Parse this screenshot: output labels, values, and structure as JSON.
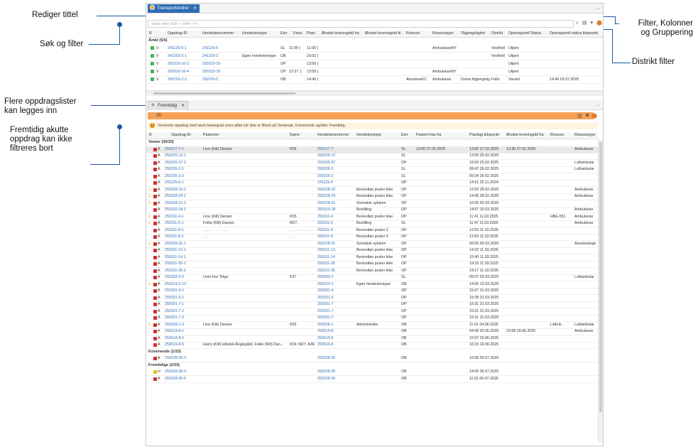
{
  "callouts": {
    "rediger": "Rediger tittel",
    "sok": "Søk og filter",
    "flere_1": "Flere oppdragslister",
    "flere_2": "kan legges inn",
    "fremtidig_1": "Fremtidig akutte",
    "fremtidig_2": "oppdrag kan ikke",
    "fremtidig_3": "filtreres bort",
    "filter_1": "Filter, Kolonner",
    "filter_2": "og Gruppering",
    "distrikt": "Distrikt filter"
  },
  "panel1": {
    "tab_label": "Transportordrer",
    "search_placeholder": "Søke etter (Ctrl + Shift + F)",
    "columns": [
      "R",
      "Oppdrag-ID",
      "Hendelsesnummer",
      "Hendelsestype",
      "Eier",
      "Fasis",
      "Planl",
      "Ønsket leveringstid fra",
      "Ønsket leveringstid til",
      "Ressurs",
      "Ressurstype",
      "Tilgjengelighet",
      "Distrikt",
      "Operasjonell Status",
      "Operasjonell status tidspunkt"
    ],
    "group": "Åmkt (5/5)",
    "rows": [
      {
        "p": "V",
        "id": "241129-6-1",
        "hn": "241129-6",
        "ht": "",
        "eier": "SL",
        "fasis": "11:00 (",
        "planl": "11:00 (",
        "res": "",
        "rtype": "AmbulanseNY",
        "tilg": "",
        "dist": "Vestfold",
        "ops": "Ulijent",
        "opt": ""
      },
      {
        "p": "V",
        "id": "241203-2-1",
        "hn": "241203-2",
        "ht": "Egen hendelsestype",
        "eier": "UB",
        "fasis": "",
        "planl": "10:52 (",
        "res": "",
        "rtype": "",
        "tilg": "",
        "dist": "Vestfold",
        "ops": "Ulijent",
        "opt": ""
      },
      {
        "p": "V",
        "id": "250310-10-2",
        "hn": "250310-10",
        "ht": "",
        "eier": "OP",
        "fasis": "",
        "planl": "13:59 (",
        "res": "",
        "rtype": "",
        "tilg": "",
        "dist": "",
        "ops": "Ulijent",
        "opt": ""
      },
      {
        "p": "V",
        "id": "250310-10-4",
        "hn": "250310-10",
        "ht": "",
        "eier": "OP",
        "fasis": "12:37 1",
        "planl": "13:59 (",
        "res": "",
        "rtype": "AmbulanseNY",
        "tilg": "",
        "dist": "",
        "ops": "Ulijent",
        "opt": ""
      },
      {
        "p": "V",
        "id": "250703-2-2",
        "hn": "250703-2",
        "ht": "",
        "eier": "OB",
        "fasis": "",
        "planl": "14:40 (",
        "res": "AbulanseFC",
        "rtype": "Ambulanse",
        "tilg": "Delvis tilgjengelig",
        "dist": "Follo",
        "ops": "Varslet",
        "opt": "14:49 03.07.2025"
      }
    ]
  },
  "panel2": {
    "tab_label": "Fremtidig",
    "filter_text": "25",
    "info_text": "Ventende oppdrag med akutt hastegrad vises alltid når liste er filtrert på Ventende, Kommende og/eller Fremtidig.",
    "columns": [
      "R",
      "Oppdrag-ID",
      "Pasienter",
      "Kjønn",
      "Hendelsesnummer",
      "Hendelsestype",
      "Eier",
      "Pasient klar fra",
      "Planlagt tidspunkt",
      "Ønsket leveringstid fra",
      "Ressurs",
      "Ressurstype"
    ],
    "groups": [
      {
        "label": "Venter (30/33)",
        "rows": [
          {
            "w": "",
            "c": "red",
            "p": "A",
            "id": "250227-7-1",
            "pas": "Line (Kilt) Danser",
            "k": "K55",
            "hn": "250227-7",
            "ht": "",
            "e": "SL",
            "kf": "13:00 27.02.2025",
            "pt": "13:00 27.02.2025",
            "ol": "13:30 27.02.2025",
            "r": "",
            "rt": "Ambulanse",
            "sel": true
          },
          {
            "w": "",
            "c": "red",
            "p": "A",
            "id": "250225-12-1",
            "pas": "",
            "k": "",
            "hn": "250225-12",
            "ht": "",
            "e": "SL",
            "kf": "",
            "pt": "13:55 25.02.2025",
            "ol": "",
            "r": "",
            "rt": ""
          },
          {
            "w": "",
            "c": "red",
            "p": "A",
            "id": "250225-37-2",
            "pas": "",
            "k": "",
            "hn": "250225-37",
            "ht": "",
            "e": "OP",
            "kf": "",
            "pt": "16:02 25.02.2025",
            "ol": "",
            "r": "",
            "rt": "Luftambular"
          },
          {
            "w": "",
            "c": "red",
            "p": "A",
            "id": "250226-2-1",
            "pas": "",
            "k": "",
            "hn": "250226-2",
            "ht": "",
            "e": "SL",
            "kf": "",
            "pt": "09:47 26.02.2025",
            "ol": "",
            "r": "",
            "rt": "Luftambular"
          },
          {
            "w": "",
            "c": "red",
            "p": "A",
            "id": "250226-2-2",
            "pas": "",
            "k": "",
            "hn": "250226-2",
            "ht": "",
            "e": "SL",
            "kf": "",
            "pt": "09:34 26.02.2025",
            "ol": "",
            "r": "",
            "rt": ""
          },
          {
            "w": "",
            "c": "red",
            "p": "A",
            "id": "241125-6-1",
            "pas": "",
            "k": "",
            "hn": "241125-6",
            "ht": "",
            "e": "OP",
            "kf": "",
            "pt": "14:51 25.11.2024",
            "ol": "",
            "r": "",
            "rt": ""
          },
          {
            "w": "⚠",
            "c": "red",
            "p": "A",
            "id": "250228-10-1",
            "pas": "",
            "k": "",
            "hn": "250228-10",
            "ht": "Bevisstløs puster ikke",
            "e": "OP",
            "kf": "",
            "pt": "12:52 28.02.2025",
            "ol": "",
            "r": "",
            "rt": "Ambulanse"
          },
          {
            "w": "⚠",
            "c": "red",
            "p": "A",
            "id": "250228-29-1",
            "pas": "",
            "k": "",
            "hn": "250228-29",
            "ht": "Bevisstløs puster ikke",
            "e": "OP",
            "kf": "",
            "pt": "14:06 28.02.2025",
            "ol": "",
            "r": "",
            "rt": "Ambulanse"
          },
          {
            "w": "⚠",
            "c": "red",
            "p": "A",
            "id": "250228-21-2",
            "pas": "",
            "k": "",
            "hn": "250228-21",
            "ht": "Somatisk sykdom",
            "e": "OP",
            "kf": "",
            "pt": "10:35 02.03.2025",
            "ol": "",
            "r": "",
            "rt": ""
          },
          {
            "w": "",
            "c": "red",
            "p": "A",
            "id": "250310-18-1",
            "pas": "",
            "k": "",
            "hn": "250310-18",
            "ht": "Bestilling",
            "e": "OP",
            "kf": "",
            "pt": "14:57 10.03.2025",
            "ol": "",
            "r": "",
            "rt": "Ambulanse"
          },
          {
            "w": "⚠",
            "c": "red",
            "p": "A",
            "id": "250311-4-1",
            "pas": "Line (Kilt) Danser",
            "k": "K55",
            "hn": "250311-4",
            "ht": "Bevisstløs puster ikke",
            "e": "OP",
            "kf": "",
            "pt": "11:41 11.03.2025",
            "ol": "",
            "r": "HBE-551",
            "rt": "Ambulanse"
          },
          {
            "w": "⚠",
            "c": "red",
            "p": "A",
            "id": "250311-6-1",
            "pas": "Folke (Kilt) Danser,",
            "k": "M27,",
            "hn": "250311-6",
            "ht": "Bestilling",
            "e": "SL",
            "kf": "",
            "pt": "11:47 11.03.2025",
            "ol": "",
            "r": "",
            "rt": "Ambulanse"
          },
          {
            "w": "",
            "c": "red",
            "p": "A",
            "id": "250311-8-1",
            "pas": ". . . . . . . . . . . .",
            "k": ". . . . . . . . . . . .",
            "hn": "250311-8",
            "ht": "Bevisstløs puster 2",
            "e": "OP",
            "kf": "",
            "pt": "12:53 11.03.2025",
            "ol": "",
            "r": "",
            "rt": ""
          },
          {
            "w": "",
            "c": "red",
            "p": "A",
            "id": "250311-8-2",
            "pas": ". . .",
            "k": ". . .",
            "hn": "250311-8",
            "ht": "Bevisstløs puster 2",
            "e": "OP",
            "kf": "",
            "pt": "12:53 11.03.2025",
            "ol": "",
            "r": "",
            "rt": ""
          },
          {
            "w": "⚠",
            "c": "red",
            "p": "A",
            "id": "250228-31-1",
            "pas": "",
            "k": "",
            "hn": "250228-31",
            "ht": "Somatisk sykdom",
            "e": "OP",
            "kf": "",
            "pt": "09:59 03.03.2025",
            "ol": "",
            "r": "",
            "rt": "Anestesilege"
          },
          {
            "w": "",
            "c": "red",
            "p": "A",
            "id": "250311-13-1",
            "pas": "",
            "k": "",
            "hn": "250311-13",
            "ht": "Bevisstløs puster ikke",
            "e": "OP",
            "kf": "",
            "pt": "14:22 11.03.2025",
            "ol": "",
            "r": "",
            "rt": ""
          },
          {
            "w": "",
            "c": "red",
            "p": "A",
            "id": "250311-14-1",
            "pas": "",
            "k": "",
            "hn": "250311-14",
            "ht": "Bevisstløs puster ikke",
            "e": "OP",
            "kf": "",
            "pt": "15:40 11.03.2025",
            "ol": "",
            "r": "",
            "rt": ""
          },
          {
            "w": "",
            "c": "red",
            "p": "A",
            "id": "250311-35-1",
            "pas": "",
            "k": "",
            "hn": "250311-35",
            "ht": "Bevisstløs puster ikke",
            "e": "OP",
            "kf": "",
            "pt": "19:15 11.03.2025",
            "ol": "",
            "r": "",
            "rt": ""
          },
          {
            "w": "",
            "c": "red",
            "p": "A",
            "id": "250311-35-2",
            "pas": "",
            "k": "",
            "hn": "250311-35",
            "ht": "Bevisstløs puster ikke",
            "e": "OP",
            "kf": "",
            "pt": "19:17 11.03.2025",
            "ol": "",
            "r": "",
            "rt": ""
          },
          {
            "w": "",
            "c": "red",
            "p": "A",
            "id": "250303-2-5",
            "pas": "Unni Fox Tolga",
            "k": "K37",
            "hn": "250303-2",
            "ht": "",
            "e": "SL",
            "kf": "",
            "pt": "09:37 03.03.2025",
            "ol": "",
            "r": "",
            "rt": "Luftambular"
          },
          {
            "w": "⚠",
            "c": "red",
            "p": "A",
            "id": "250313-2-13",
            "pas": "",
            "k": "",
            "hn": "250313-2",
            "ht": "Egen hendelsestype",
            "e": "OB",
            "kf": "",
            "pt": "14:55 13.03.2025",
            "ol": "",
            "r": "",
            "rt": ""
          },
          {
            "w": "",
            "c": "red",
            "p": "A",
            "id": "250331-4-1",
            "pas": "",
            "k": "",
            "hn": "250331-4",
            "ht": "",
            "e": "OP",
            "kf": "",
            "pt": "15:27 31.03.2025",
            "ol": "",
            "r": "",
            "rt": ""
          },
          {
            "w": "",
            "c": "red",
            "p": "A",
            "id": "250331-5-1",
            "pas": "",
            "k": "",
            "hn": "250331-5",
            "ht": "",
            "e": "OP",
            "kf": "",
            "pt": "15:28 31.03.2025",
            "ol": "",
            "r": "",
            "rt": ""
          },
          {
            "w": "",
            "c": "red",
            "p": "A",
            "id": "250331-7-1",
            "pas": "",
            "k": "",
            "hn": "250331-7",
            "ht": "",
            "e": "OP",
            "kf": "",
            "pt": "15:31 31.03.2025",
            "ol": "",
            "r": "",
            "rt": ""
          },
          {
            "w": "",
            "c": "red",
            "p": "A",
            "id": "250331-7-2",
            "pas": "",
            "k": "",
            "hn": "250331-7",
            "ht": "",
            "e": "OP",
            "kf": "",
            "pt": "15:31 31.03.2025",
            "ol": "",
            "r": "",
            "rt": ""
          },
          {
            "w": "",
            "c": "red",
            "p": "A",
            "id": "250331-7-3",
            "pas": "",
            "k": "",
            "hn": "250331-7",
            "ht": "",
            "e": "OP",
            "kf": "",
            "pt": "15:31 31.03.2025",
            "ol": "",
            "r": "",
            "rt": ""
          },
          {
            "w": "⚠",
            "c": "red",
            "p": "A",
            "id": "250528-1-3",
            "pas": "Line (Kilt) Danser",
            "k": "K55",
            "hn": "250528-1",
            "ht": "Administrativ",
            "e": "OB",
            "kf": "",
            "pt": "11:01 04.06.2025",
            "ol": "",
            "r": "LAErik",
            "rt": "Luftambular"
          },
          {
            "w": "",
            "c": "red",
            "p": "A",
            "id": "250619-8-1",
            "pas": "",
            "k": "",
            "hn": "250619-8",
            "ht": "",
            "e": "OB",
            "kf": "",
            "pt": "04:58 20.06.2025",
            "ol": "15:58 19.06.2025",
            "r": "",
            "rt": "Ambulanse"
          },
          {
            "w": "",
            "c": "red",
            "p": "A",
            "id": "250619-8-2",
            "pas": "",
            "k": "",
            "hn": "250619-8",
            "ht": "",
            "e": "OB",
            "kf": "",
            "pt": "22:07 20.06.2025",
            "ol": "",
            "r": "",
            "rt": ""
          },
          {
            "w": "",
            "c": "red",
            "p": "A",
            "id": "250619-8-5",
            "pas": "Harrý (Kilt) Håndel-Ånglegård, Folke (Kilt) Dan...",
            "k": "K54; M27, K46",
            "hn": "250619-8",
            "ht": "",
            "e": "OB",
            "kf": "",
            "pt": "16:15 19.06.2025",
            "ol": "",
            "r": "",
            "rt": ""
          }
        ]
      },
      {
        "label": "Kommende (1/33)",
        "rows": [
          {
            "w": "",
            "c": "red",
            "p": "A",
            "id": "250228-35-3",
            "pas": "",
            "k": "",
            "hn": "250228-35",
            "ht": "",
            "e": "OB",
            "kf": "",
            "pt": "10:58 05.07.2025",
            "ol": "",
            "r": "",
            "rt": ""
          }
        ]
      },
      {
        "label": "Fremtidige (2/33)",
        "rows": [
          {
            "w": "",
            "c": "yellow",
            "p": "H",
            "id": "250228-35-4",
            "pas": "",
            "k": "",
            "hn": "250228-35",
            "ht": "",
            "e": "OB",
            "kf": "",
            "pt": "14:00 06.07.2025",
            "ol": "",
            "r": "",
            "rt": ""
          },
          {
            "w": "",
            "c": "red",
            "p": "A",
            "id": "250228-35-5",
            "pas": "",
            "k": "",
            "hn": "250228-35",
            "ht": "",
            "e": "OB",
            "kf": "",
            "pt": "11:01 06.07.2025",
            "ol": "",
            "r": "",
            "rt": ""
          }
        ]
      }
    ]
  },
  "colors": {
    "accent": "#2f6db5",
    "callout_line": "#1d5aa8",
    "filter_bar": "#f5a055",
    "urgent": "#d32f2f",
    "medium": "#e8c21a",
    "ok": "#4caf50"
  },
  "icons": [
    "chevron-down-icon",
    "close-icon",
    "search-icon",
    "filter-icon",
    "columns-icon",
    "group-icon",
    "warning-icon",
    "info-icon"
  ]
}
